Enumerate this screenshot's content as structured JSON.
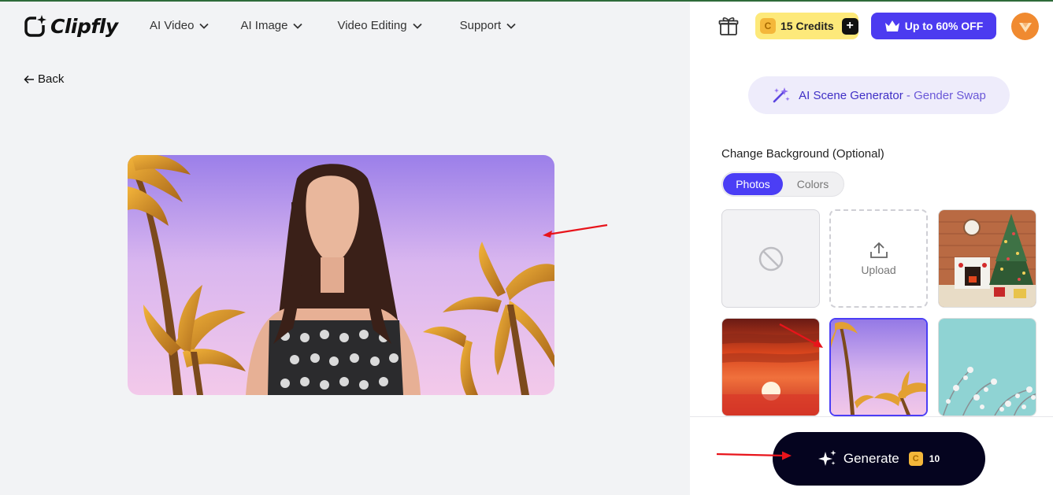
{
  "brand": {
    "name": "Clipfly"
  },
  "nav": {
    "items": [
      {
        "label": "AI Video"
      },
      {
        "label": "AI Image"
      },
      {
        "label": "Video Editing"
      },
      {
        "label": "Support"
      }
    ]
  },
  "back": {
    "label": "Back"
  },
  "header": {
    "credits_label": "15 Credits",
    "coin_symbol": "C",
    "plus_symbol": "+",
    "offer_label": "Up to 60% OFF"
  },
  "panel": {
    "scene_title_main": "AI Scene Generator",
    "scene_title_suffix": " - Gender Swap",
    "section_title": "Change Background (Optional)",
    "tabs": [
      {
        "label": "Photos",
        "active": true
      },
      {
        "label": "Colors",
        "active": false
      }
    ],
    "upload_label": "Upload",
    "backgrounds": [
      {
        "kind": "none-icon"
      },
      {
        "kind": "upload-icon"
      },
      {
        "kind": "christmas-fireplace-photo"
      },
      {
        "kind": "red-sunset-photo"
      },
      {
        "kind": "purple-palm-photo",
        "selected": true
      },
      {
        "kind": "teal-blossom-photo"
      }
    ]
  },
  "generate": {
    "label": "Generate",
    "cost": "10",
    "coin_symbol": "C"
  },
  "colors": {
    "accent": "#4b3ef5",
    "generate_bg": "#05041f",
    "credits_bg": "#fde97a",
    "annotation_arrow": "#e8141b"
  }
}
